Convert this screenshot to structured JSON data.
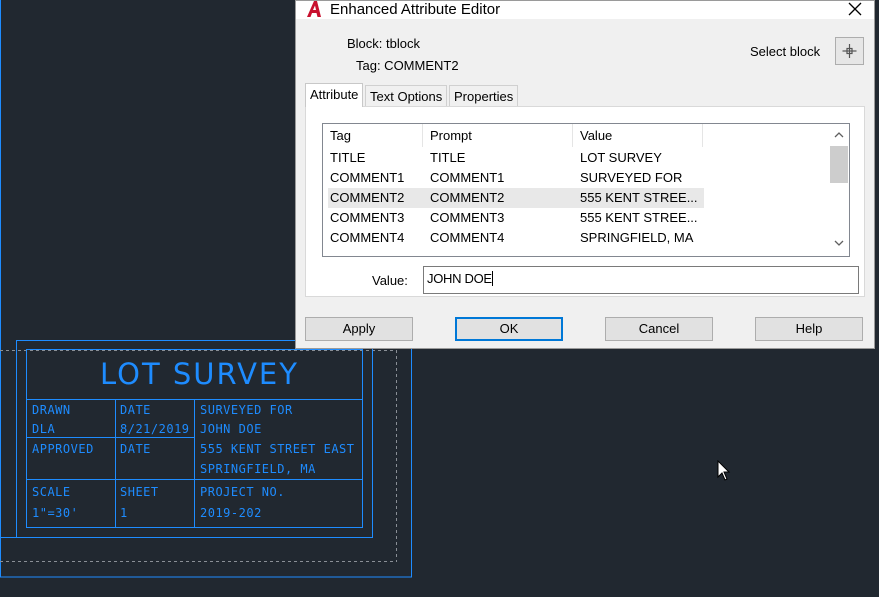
{
  "drawing": {
    "title": "LOT SURVEY",
    "cells": {
      "drawn_label": "DRAWN",
      "drawn_value": "DLA",
      "date_label": "DATE",
      "date_value": "8/21/2019",
      "surveyed_label": "SURVEYED FOR",
      "surveyed_value": "JOHN DOE",
      "approved_label": "APPROVED",
      "date2_label": "DATE",
      "address1": "555 KENT STREET EAST",
      "address2": "SPRINGFIELD, MA",
      "scale_label": "SCALE",
      "scale_value": "1\"=30'",
      "sheet_label": "SHEET",
      "sheet_value": "1",
      "project_label": "PROJECT NO.",
      "project_value": "2019-202"
    },
    "line_color": "#1e8cff"
  },
  "dialog": {
    "title": "Enhanced Attribute Editor",
    "logo_icon": "autocad-logo-icon",
    "block_label": "Block: tblock",
    "tag_label": "Tag: COMMENT2",
    "select_block_label": "Select block",
    "tabs": [
      {
        "label": "Attribute",
        "active": true
      },
      {
        "label": "Text Options",
        "active": false
      },
      {
        "label": "Properties",
        "active": false
      }
    ],
    "columns": [
      "Tag",
      "Prompt",
      "Value"
    ],
    "rows": [
      {
        "tag": "TITLE",
        "prompt": "TITLE",
        "value": "LOT SURVEY",
        "selected": false
      },
      {
        "tag": "COMMENT1",
        "prompt": "COMMENT1",
        "value": "SURVEYED FOR",
        "selected": false
      },
      {
        "tag": "COMMENT2",
        "prompt": "COMMENT2",
        "value": "555 KENT STREE...",
        "selected": true
      },
      {
        "tag": "COMMENT3",
        "prompt": "COMMENT3",
        "value": "555 KENT STREE...",
        "selected": false
      },
      {
        "tag": "COMMENT4",
        "prompt": "COMMENT4",
        "value": "SPRINGFIELD, MA",
        "selected": false
      }
    ],
    "value_label": "Value:",
    "value_input": "JOHN DOE",
    "buttons": {
      "apply": "Apply",
      "ok": "OK",
      "cancel": "Cancel",
      "help": "Help"
    },
    "accent": "#0078d7"
  }
}
